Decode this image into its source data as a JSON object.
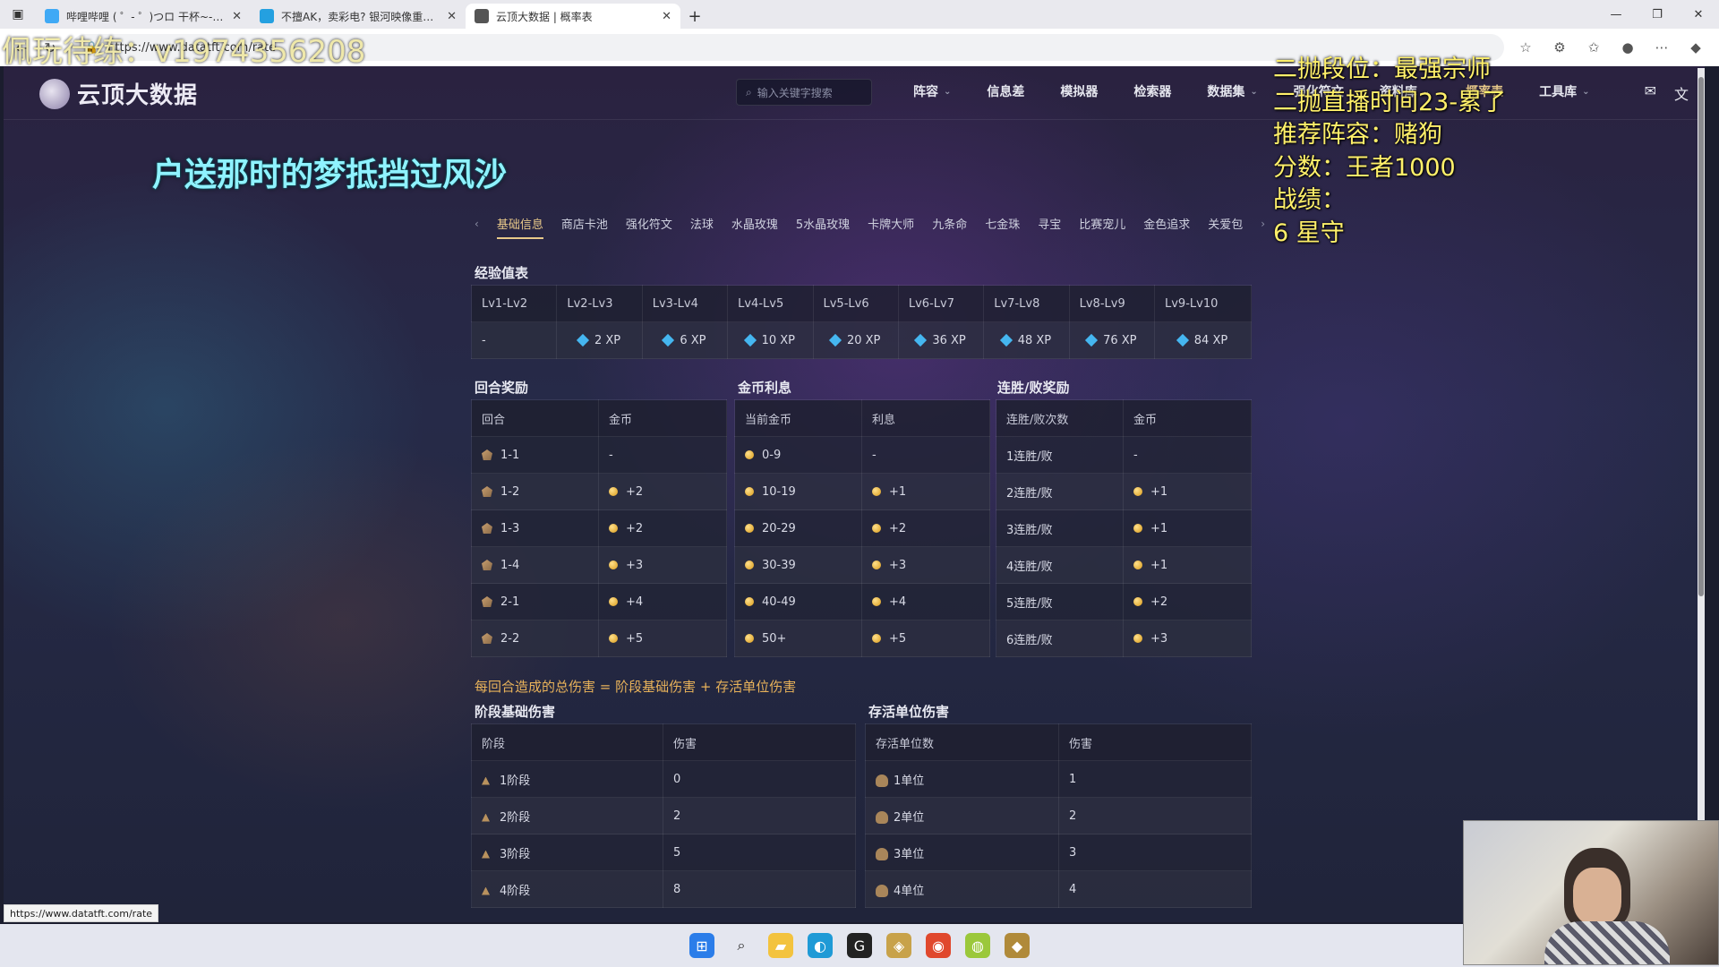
{
  "browser": {
    "tabs": [
      {
        "title": "哔哩哔哩 ( ゜- ゜)つロ 干杯~-bilibili",
        "active": false
      },
      {
        "title": "不擅AK，卖彩电? 银河映像重组影",
        "active": false
      },
      {
        "title": "云顶大数据 | 概率表",
        "active": true
      }
    ],
    "new_tab": "+",
    "url": "https://www.datatft.com/rate",
    "status_url": "https://www.datatft.com/rate"
  },
  "site": {
    "logo_text": "云顶大数据",
    "search_placeholder": "输入关键字搜索",
    "nav": [
      {
        "label": "阵容",
        "dropdown": true
      },
      {
        "label": "信息差",
        "dropdown": false
      },
      {
        "label": "模拟器",
        "dropdown": false
      },
      {
        "label": "检索器",
        "dropdown": false
      },
      {
        "label": "数据集",
        "dropdown": true
      },
      {
        "label": "强化符文",
        "dropdown": false
      },
      {
        "label": "资料库",
        "dropdown": true
      },
      {
        "label": "概率表",
        "dropdown": false
      },
      {
        "label": "工具库",
        "dropdown": true
      }
    ]
  },
  "subtabs": [
    "基础信息",
    "商店卡池",
    "强化符文",
    "法球",
    "水晶玫瑰",
    "5水晶玫瑰",
    "卡牌大师",
    "九条命",
    "七金珠",
    "寻宝",
    "比赛宠儿",
    "金色追求",
    "关爱包"
  ],
  "xp_table": {
    "title": "经验值表",
    "headers": [
      "Lv1-Lv2",
      "Lv2-Lv3",
      "Lv3-Lv4",
      "Lv4-Lv5",
      "Lv5-Lv6",
      "Lv6-Lv7",
      "Lv7-Lv8",
      "Lv8-Lv9",
      "Lv9-Lv10"
    ],
    "values": [
      "-",
      "2 XP",
      "6 XP",
      "10 XP",
      "20 XP",
      "36 XP",
      "48 XP",
      "76 XP",
      "84 XP"
    ]
  },
  "round_reward": {
    "title": "回合奖励",
    "headers": [
      "回合",
      "金币"
    ],
    "rows": [
      [
        "1-1",
        "-"
      ],
      [
        "1-2",
        "+2"
      ],
      [
        "1-3",
        "+2"
      ],
      [
        "1-4",
        "+3"
      ],
      [
        "2-1",
        "+4"
      ],
      [
        "2-2",
        "+5"
      ]
    ]
  },
  "interest": {
    "title": "金币利息",
    "headers": [
      "当前金币",
      "利息"
    ],
    "rows": [
      [
        "0-9",
        "-"
      ],
      [
        "10-19",
        "+1"
      ],
      [
        "20-29",
        "+2"
      ],
      [
        "30-39",
        "+3"
      ],
      [
        "40-49",
        "+4"
      ],
      [
        "50+",
        "+5"
      ]
    ]
  },
  "streak": {
    "title": "连胜/败奖励",
    "headers": [
      "连胜/败次数",
      "金币"
    ],
    "rows": [
      [
        "1连胜/败",
        "-"
      ],
      [
        "2连胜/败",
        "+1"
      ],
      [
        "3连胜/败",
        "+1"
      ],
      [
        "4连胜/败",
        "+1"
      ],
      [
        "5连胜/败",
        "+2"
      ],
      [
        "6连胜/败",
        "+3"
      ]
    ]
  },
  "damage_formula": "每回合造成的总伤害 = 阶段基础伤害 + 存活单位伤害",
  "stage_damage": {
    "title": "阶段基础伤害",
    "headers": [
      "阶段",
      "伤害"
    ],
    "rows": [
      [
        "1阶段",
        "0"
      ],
      [
        "2阶段",
        "2"
      ],
      [
        "3阶段",
        "5"
      ],
      [
        "4阶段",
        "8"
      ]
    ]
  },
  "unit_damage": {
    "title": "存活单位伤害",
    "headers": [
      "存活单位数",
      "伤害"
    ],
    "rows": [
      [
        "1单位",
        "1"
      ],
      [
        "2单位",
        "2"
      ],
      [
        "3单位",
        "3"
      ],
      [
        "4单位",
        "4"
      ]
    ]
  },
  "overlays": {
    "lyric": "户送那时的梦抵挡过风沙",
    "top_left": "佩玩待练：v1974356208",
    "right_lines": [
      "二抛段位：最强宗师",
      "二抛直播时间23-累了",
      "推荐阵容：赌狗",
      "分数：王者1000",
      "战绩：",
      "6 星守"
    ]
  }
}
